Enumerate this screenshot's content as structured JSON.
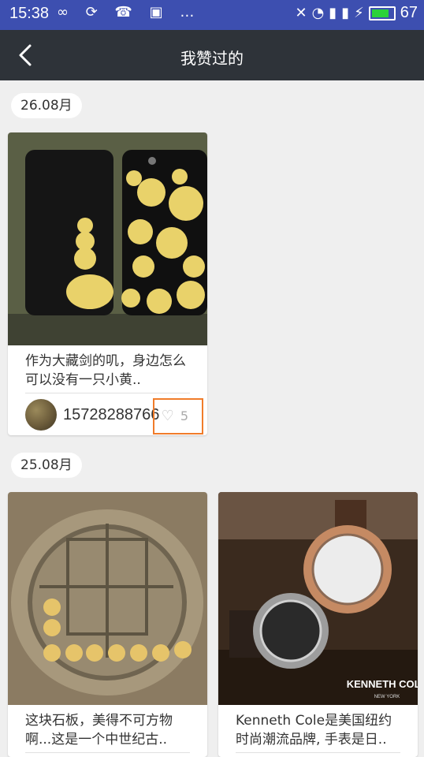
{
  "status": {
    "time": "15:38",
    "battery": "67"
  },
  "header": {
    "title": "我赞过的"
  },
  "sections": [
    {
      "date": "26.08月",
      "cards": [
        {
          "desc": "作为大藏剑的叽，身边怎么可以没有一只小黄..",
          "user": "15728288766",
          "likes": "5"
        }
      ]
    },
    {
      "date": "25.08月",
      "cards": [
        {
          "desc": "这块石板，美得不可方物啊...这是一个中世纪古.."
        },
        {
          "desc": "Kenneth Cole是美国纽约时尚潮流品牌, 手表是日..",
          "brand_text": "KENNETH COLE",
          "brand_sub": "NEW YORK"
        }
      ]
    }
  ],
  "colors": {
    "status_bar": "#3d4fb0",
    "top_bar": "#2e3339",
    "highlight": "#f07c2a"
  }
}
